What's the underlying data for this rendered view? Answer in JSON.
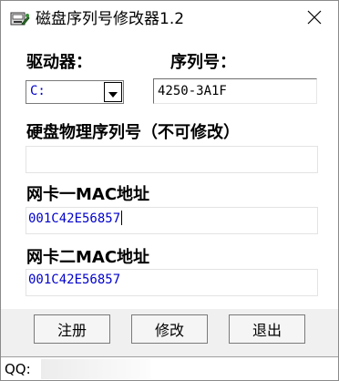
{
  "window": {
    "title": "磁盘序列号修改器1.2"
  },
  "labels": {
    "drive": "驱动器：",
    "serial": "序列号：",
    "hdd_serial": "硬盘物理序列号（不可修改）",
    "nic1_mac": "网卡一MAC地址",
    "nic2_mac": "网卡二MAC地址"
  },
  "fields": {
    "drive_selected": "C:",
    "serial_value": "4250-3A1F",
    "hdd_serial_value": "",
    "nic1_mac_value": "001C42E56857",
    "nic2_mac_value": "001C42E56857"
  },
  "buttons": {
    "register": "注册",
    "modify": "修改",
    "exit": "退出"
  },
  "status": {
    "qq_label": "QQ:"
  },
  "icons": {
    "app": "disk-tool-icon",
    "close": "close-icon",
    "dropdown": "triangle-down-icon"
  }
}
